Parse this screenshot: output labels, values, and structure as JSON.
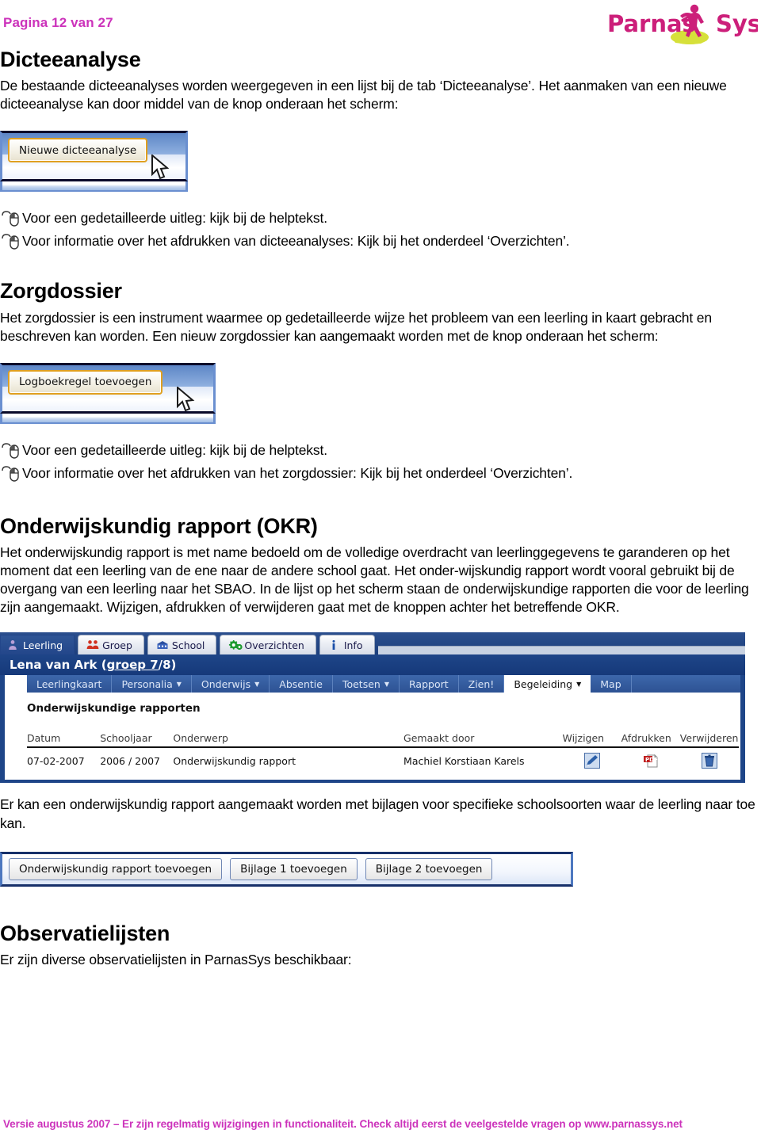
{
  "header": {
    "page_label": "Pagina 12 van 27",
    "logo_text_1": "Parnas",
    "logo_text_2": "Sys",
    "logo_color": "#cc1f7a",
    "logo_splash_color": "#d6e03a"
  },
  "sections": {
    "dicteeanalyse": {
      "heading": "Dicteeanalyse",
      "paragraph": "De bestaande dicteeanalyses worden weergegeven in een lijst bij de tab ‘Dicteeanalyse’. Het aanmaken van een nieuwe dicteeanalyse kan door middel van de knop onderaan het scherm:",
      "screenshot_button": "Nieuwe dicteeanalyse",
      "bullets": [
        "Voor een gedetailleerde uitleg: kijk bij de helptekst.",
        "Voor informatie over het afdrukken van dicteeanalyses: Kijk bij het onderdeel ‘Overzichten’."
      ]
    },
    "zorgdossier": {
      "heading": "Zorgdossier",
      "paragraph": "Het zorgdossier is een instrument waarmee op gedetailleerde wijze het probleem van een leerling in kaart gebracht en beschreven kan worden. Een nieuw zorgdossier kan aangemaakt worden met de knop onderaan het scherm:",
      "screenshot_button": "Logboekregel toevoegen",
      "bullets": [
        "Voor een gedetailleerde uitleg: kijk bij de helptekst.",
        "Voor informatie over het afdrukken van het zorgdossier: Kijk bij het onderdeel ‘Overzichten’."
      ]
    },
    "okr": {
      "heading": "Onderwijskundig rapport (OKR)",
      "paragraph": "Het onderwijskundig rapport is met name bedoeld om de volledige overdracht van leerlinggegevens te garanderen op het moment dat een leerling van de ene naar de andere school gaat. Het onder-wijskundig rapport wordt vooral gebruikt bij de overgang van een leerling naar het SBAO. In de lijst op het scherm staan de onderwijskundige rapporten die voor de leerling zijn aangemaakt. Wijzigen, afdrukken of verwijderen gaat met de knoppen achter het betreffende OKR.",
      "paragraph_after": "Er kan een onderwijskundig rapport aangemaakt worden met bijlagen voor specifieke schoolsoorten waar de leerling naar toe kan."
    },
    "observatielijsten": {
      "heading": "Observatielijsten",
      "paragraph": "Er zijn diverse observatielijsten in ParnasSys beschikbaar:"
    }
  },
  "appshot": {
    "tabs": [
      {
        "label": "Leerling",
        "icon": "person-icon",
        "active": true
      },
      {
        "label": "Groep",
        "icon": "people-icon",
        "active": false
      },
      {
        "label": "School",
        "icon": "school-icon",
        "active": false
      },
      {
        "label": "Overzichten",
        "icon": "gears-icon",
        "active": false
      },
      {
        "label": "Info",
        "icon": "info-icon",
        "active": false
      }
    ],
    "student_title_prefix": "Lena van Ark (",
    "student_title_link": "groep 7",
    "student_title_suffix": "8)",
    "student_title_sep": "/",
    "subnav": [
      {
        "label": "Leerlingkaart",
        "active": false,
        "caret": false
      },
      {
        "label": "Personalia",
        "active": false,
        "caret": true
      },
      {
        "label": "Onderwijs",
        "active": false,
        "caret": true
      },
      {
        "label": "Absentie",
        "active": false,
        "caret": false
      },
      {
        "label": "Toetsen",
        "active": false,
        "caret": true
      },
      {
        "label": "Rapport",
        "active": false,
        "caret": false
      },
      {
        "label": "Zien!",
        "active": false,
        "caret": false
      },
      {
        "label": "Begeleiding",
        "active": true,
        "caret": true
      },
      {
        "label": "Map",
        "active": false,
        "caret": false
      }
    ],
    "panel_heading": "Onderwijskundige rapporten",
    "table": {
      "columns": [
        "Datum",
        "Schooljaar",
        "Onderwerp",
        "Gemaakt door",
        "Wijzigen",
        "Afdrukken",
        "Verwijderen"
      ],
      "rows": [
        {
          "datum": "07-02-2007",
          "schooljaar": "2006 / 2007",
          "onderwerp": "Onderwijskundig rapport",
          "gemaakt_door": "Machiel Korstiaan Karels",
          "wijzigen_icon": "edit-pencil-icon",
          "afdrukken_icon": "pdf-print-icon",
          "verwijderen_icon": "delete-bin-icon"
        }
      ]
    },
    "action_buttons": [
      "Onderwijskundig rapport toevoegen",
      "Bijlage 1 toevoegen",
      "Bijlage 2 toevoegen"
    ]
  },
  "footer": {
    "text": "Versie augustus 2007 – Er zijn regelmatig wijzigingen in functionaliteit. Check altijd eerst de veelgestelde vragen op www.parnassys.net",
    "color": "#cc33bb"
  }
}
